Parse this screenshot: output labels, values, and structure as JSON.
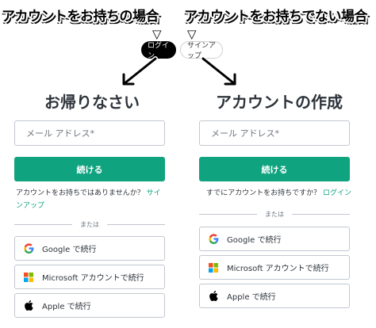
{
  "annotations": {
    "left_caption": "アカウントをお持ちの場合",
    "right_caption": "アカウントをお持ちでない場合",
    "triangle": "▽"
  },
  "header_pills": {
    "login": "ログイン",
    "signup": "サインアップ"
  },
  "login_panel": {
    "title": "お帰りなさい",
    "email_placeholder": "メール アドレス*",
    "continue": "続ける",
    "helper_text": "アカウントをお持ちではありませんか？",
    "helper_link": "サインアップ",
    "or": "または",
    "social": [
      {
        "label": "Google で続行",
        "icon": "google-icon"
      },
      {
        "label": "Microsoft アカウントで続行",
        "icon": "microsoft-icon"
      },
      {
        "label": "Apple で続行",
        "icon": "apple-icon"
      }
    ]
  },
  "signup_panel": {
    "title": "アカウントの作成",
    "email_placeholder": "メール アドレス*",
    "continue": "続ける",
    "helper_text": "すでにアカウントをお持ちですか？",
    "helper_link": "ログイン",
    "or": "または",
    "social": [
      {
        "label": "Google で続行",
        "icon": "google-icon"
      },
      {
        "label": "Microsoft アカウントで続行",
        "icon": "microsoft-icon"
      },
      {
        "label": "Apple で続行",
        "icon": "apple-icon"
      }
    ]
  },
  "colors": {
    "accent": "#10a37f",
    "text": "#2d333a",
    "border": "#c2c8d0"
  }
}
